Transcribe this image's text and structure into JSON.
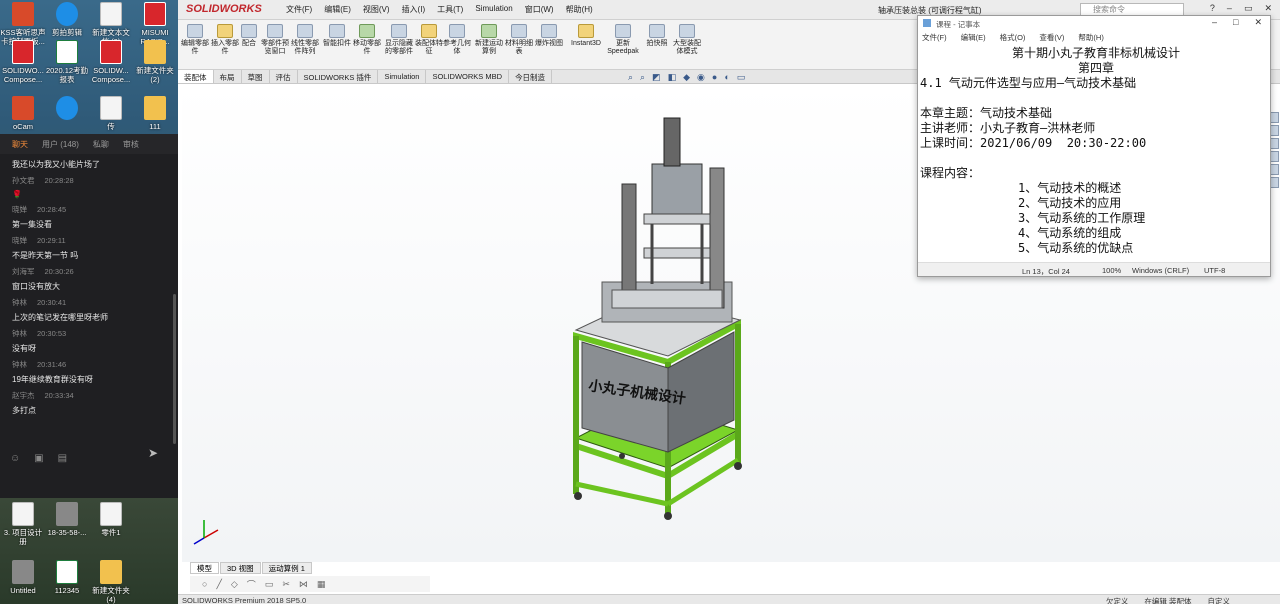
{
  "desktop": {
    "icons": [
      {
        "label": "KSS客听思声 卡控制面板..."
      },
      {
        "label": "剪拍剪辑"
      },
      {
        "label": "新建文本文 档 (9)"
      },
      {
        "label": "MISUMI RAPID..."
      },
      {
        "label": "SOLIDWO... Compose..."
      },
      {
        "label": "2020.12考勤 报表"
      },
      {
        "label": "SOLIDW... Compose..."
      },
      {
        "label": "新建文件夹 (2)"
      },
      {
        "label": "oCam"
      },
      {
        "label": "传"
      },
      {
        "label": "111"
      },
      {
        "label": "3. 项目设计 册"
      },
      {
        "label": "18-35-58-..."
      },
      {
        "label": "零件1"
      },
      {
        "label": "Untitled"
      },
      {
        "label": "112345"
      },
      {
        "label": "新建文件夹 (4)"
      }
    ]
  },
  "chat": {
    "tabs": [
      "聊天",
      "用户 (148)",
      "私聊",
      "审核"
    ],
    "messages": [
      {
        "who": "",
        "time": "",
        "text": "我还以为我又小能片场了"
      },
      {
        "who": "孙文君",
        "time": "20:28:28",
        "text": "🌹"
      },
      {
        "who": "晓婵",
        "time": "20:28:45",
        "text": "第一集没看"
      },
      {
        "who": "晓婵",
        "time": "20:29:11",
        "text": "不是昨天第一节 吗"
      },
      {
        "who": "刘海军",
        "time": "20:30:26",
        "text": "窗口没有放大"
      },
      {
        "who": "钟林",
        "time": "20:30:41",
        "text": "上次的笔记发在哪里呀老师"
      },
      {
        "who": "钟林",
        "time": "20:30:53",
        "text": "没有呀"
      },
      {
        "who": "钟林",
        "time": "20:31:46",
        "text": "19年继续教育群没有呀"
      },
      {
        "who": "赵宇杰",
        "time": "20:33:34",
        "text": "多打点"
      }
    ]
  },
  "solidworks": {
    "logo": "SOLIDWORKS",
    "menu": [
      "文件(F)",
      "编辑(E)",
      "视图(V)",
      "插入(I)",
      "工具(T)",
      "Simulation",
      "窗口(W)",
      "帮助(H)"
    ],
    "doc_title": "轴承压装总装 (可调行程气缸)",
    "search_placeholder": "搜索命令",
    "ribbon": [
      "编辑零部件",
      "插入零部件",
      "配合",
      "零部件预览窗口",
      "线性零部件阵列",
      "智能扣件",
      "移动零部件",
      "显示隐藏的零部件",
      "装配体特征",
      "参考几何体",
      "新建运动算例",
      "材料明细表",
      "爆炸视图",
      "Instant3D",
      "更新Speedpak",
      "拍快照",
      "大型装配体模式"
    ],
    "tabs": [
      "装配体",
      "布局",
      "草图",
      "评估",
      "SOLIDWORKS 插件",
      "Simulation",
      "SOLIDWORKS MBD",
      "今日制造"
    ],
    "bottom_tabs": [
      "模型",
      "3D 视图",
      "运动算例 1"
    ],
    "machine_label": "小丸子机械设计",
    "status_left": "SOLIDWORKS Premium 2018 SP5.0",
    "status_right": [
      "欠定义",
      "在编辑 装配体",
      "自定义"
    ]
  },
  "notepad": {
    "title": "课程 - 记事本",
    "menu": [
      "文件(F)",
      "编辑(E)",
      "格式(O)",
      "查看(V)",
      "帮助(H)"
    ],
    "lines": [
      "第十期小丸子教育非标机械设计",
      "第四章",
      "4.1 气动元件选型与应用—气动技术基础",
      "",
      "本章主题：气动技术基础",
      "主讲老师：小丸子教育—洪林老师",
      "上课时间：2021/06/09  20:30-22:00",
      "",
      "课程内容：",
      "1、气动技术的概述",
      "2、气动技术的应用",
      "3、气动系统的工作原理",
      "4、气动系统的组成",
      "5、气动系统的优缺点"
    ],
    "status": {
      "pos": "Ln 13，Col 24",
      "zoom": "100%",
      "eol": "Windows (CRLF)",
      "enc": "UTF-8"
    }
  }
}
